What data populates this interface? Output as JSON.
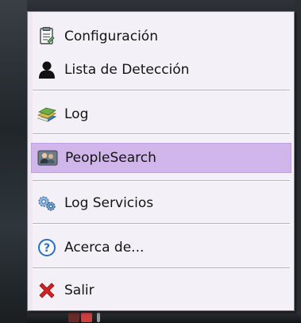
{
  "menu": {
    "items": [
      {
        "label": "Configuración",
        "icon": "config-document-icon"
      },
      {
        "label": "Lista de Detección",
        "icon": "person-silhouette-icon"
      },
      {
        "label": "Log",
        "icon": "books-stack-icon"
      },
      {
        "label": "PeopleSearch",
        "icon": "people-search-icon",
        "highlighted": true
      },
      {
        "label": "Log Servicios",
        "icon": "services-gear-icon"
      },
      {
        "label": "Acerca de...",
        "icon": "help-question-icon"
      },
      {
        "label": "Salir",
        "icon": "exit-x-icon"
      }
    ]
  },
  "colors": {
    "menu_background": "#f4f0f7",
    "highlight": "#d0b6ea",
    "exit_red": "#d22222",
    "help_blue": "#2a6fc1"
  }
}
